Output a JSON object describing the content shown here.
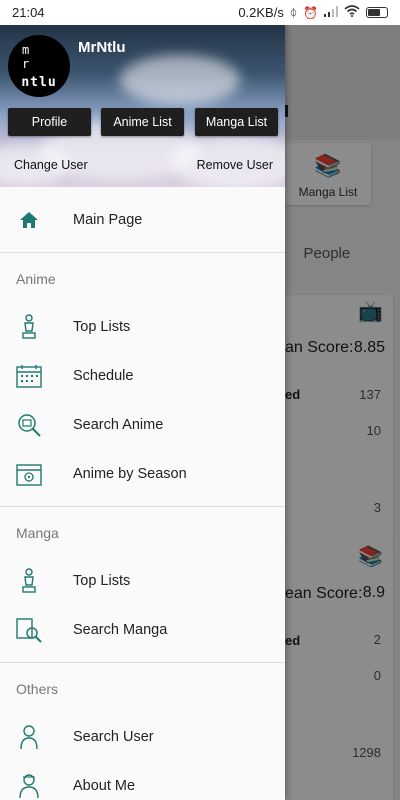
{
  "status_bar": {
    "time": "21:04",
    "net_speed": "0.2KB/s"
  },
  "background": {
    "title_fragment": "lu",
    "manga_list_btn": "Manga List",
    "tabs": [
      "s",
      "People"
    ],
    "card1": {
      "score_label": "an Score:",
      "score_value": "8.85",
      "row_label": "ed",
      "num1": "137",
      "num2": "10",
      "num3": "3"
    },
    "card2": {
      "score_label": "ean Score:",
      "score_value": "8.9",
      "row_label": "ed",
      "num1": "2",
      "num2": "0",
      "num3": "1298"
    }
  },
  "drawer": {
    "avatar_text": {
      "top": "m r",
      "bottom": "ntlu"
    },
    "username": "MrNtlu",
    "buttons": {
      "profile": "Profile",
      "anime_list": "Anime List",
      "manga_list": "Manga List"
    },
    "change_user": "Change User",
    "remove_user": "Remove User",
    "main_page": "Main Page",
    "sections": {
      "anime": {
        "title": "Anime",
        "items": [
          "Top Lists",
          "Schedule",
          "Search Anime",
          "Anime by Season"
        ]
      },
      "manga": {
        "title": "Manga",
        "items": [
          "Top Lists",
          "Search Manga"
        ]
      },
      "others": {
        "title": "Others",
        "items": [
          "Search User",
          "About Me"
        ]
      }
    }
  },
  "colors": {
    "accent": "#1f7a6e",
    "drawer_bg": "#fafafa",
    "button_bg": "#1f1f1f"
  }
}
